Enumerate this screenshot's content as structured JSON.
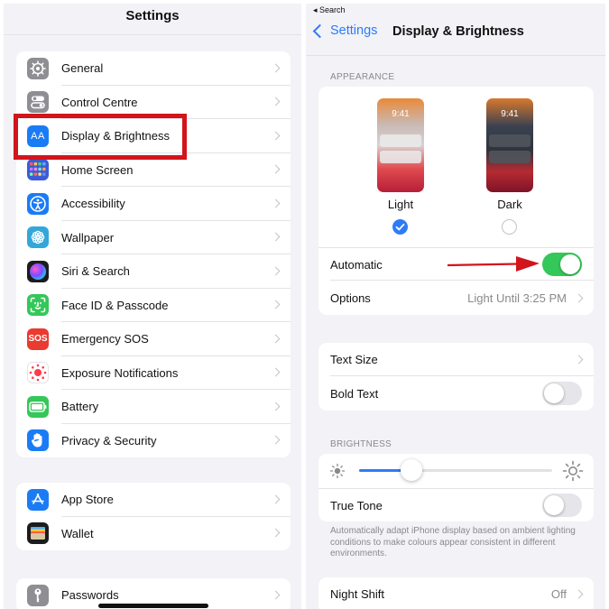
{
  "left": {
    "title": "Settings",
    "groups": [
      [
        {
          "label": "General",
          "icon": "gear-icon",
          "color": "#8e8e93"
        },
        {
          "label": "Control Centre",
          "icon": "toggles-icon",
          "color": "#8e8e93"
        },
        {
          "label": "Display & Brightness",
          "icon": "display-aa-icon",
          "color": "#1a7cf5"
        },
        {
          "label": "Home Screen",
          "icon": "home-grid-icon",
          "color": "#3b5bd9"
        },
        {
          "label": "Accessibility",
          "icon": "accessibility-icon",
          "color": "#1a7cf5"
        },
        {
          "label": "Wallpaper",
          "icon": "flower-icon",
          "color": "#34a7da"
        },
        {
          "label": "Siri & Search",
          "icon": "siri-icon",
          "color": "#1c1c1e"
        },
        {
          "label": "Face ID & Passcode",
          "icon": "face-id-icon",
          "color": "#34c759"
        },
        {
          "label": "Emergency SOS",
          "icon": "sos-icon",
          "color": "#e93b30"
        },
        {
          "label": "Exposure Notifications",
          "icon": "exposure-icon",
          "color": "#ffffff"
        },
        {
          "label": "Battery",
          "icon": "battery-icon",
          "color": "#34c759"
        },
        {
          "label": "Privacy & Security",
          "icon": "hand-icon",
          "color": "#1a7cf5"
        }
      ],
      [
        {
          "label": "App Store",
          "icon": "app-store-icon",
          "color": "#1a7cf5"
        },
        {
          "label": "Wallet",
          "icon": "wallet-icon",
          "color": "#1c1c1e"
        }
      ],
      [
        {
          "label": "Passwords",
          "icon": "key-icon",
          "color": "#8e8e93"
        }
      ]
    ]
  },
  "right": {
    "status_back": "◂ Search",
    "back_label": "Settings",
    "title": "Display & Brightness",
    "appearance_header": "APPEARANCE",
    "light_label": "Light",
    "dark_label": "Dark",
    "phone_time": "9:41",
    "automatic_label": "Automatic",
    "automatic_on": true,
    "options_label": "Options",
    "options_value": "Light Until 3:25 PM",
    "text_size_label": "Text Size",
    "bold_text_label": "Bold Text",
    "bold_text_on": false,
    "brightness_header": "BRIGHTNESS",
    "brightness_level": 0.27,
    "true_tone_label": "True Tone",
    "true_tone_on": false,
    "footnote": "Automatically adapt iPhone display based on ambient lighting conditions to make colours appear consistent in different environments.",
    "night_shift_label": "Night Shift",
    "night_shift_value": "Off"
  },
  "colors": {
    "accent": "#2d7cf6",
    "toggle_on": "#34c759",
    "highlight": "#d2141b"
  }
}
